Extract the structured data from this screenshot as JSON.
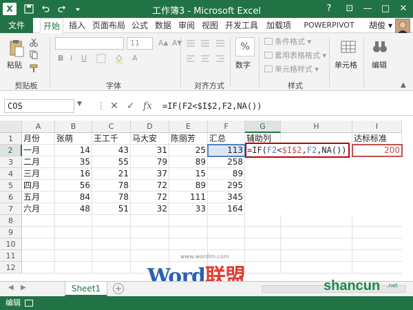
{
  "window": {
    "app_icon": "X",
    "title": "工作簿3 - Microsoft Excel",
    "controls": [
      "?",
      "⊡",
      "—",
      "□",
      "✕"
    ]
  },
  "icons": {
    "save": "save-icon",
    "undo": "undo-icon",
    "redo": "redo-icon",
    "user_avatar": "avatar-icon"
  },
  "menu": {
    "file": "文件",
    "tabs": [
      "开始",
      "插入",
      "页面布局",
      "公式",
      "数据",
      "审阅",
      "视图",
      "开发工具",
      "加载项",
      "POWERPIVOT"
    ],
    "user": "胡俊 ▾"
  },
  "ribbon": {
    "clipboard": {
      "paste": "粘贴",
      "label": "剪贴板"
    },
    "font": {
      "font_size": "11",
      "label": "字体",
      "bold": "B",
      "italic": "I",
      "underline": "U"
    },
    "align": {
      "label": "对齐方式"
    },
    "number": {
      "button": "数字",
      "symbol": "%"
    },
    "styles": {
      "cond_format": "条件格式 ▾",
      "table_format": "套用表格格式 ▾",
      "cell_style": "单元格样式 ▾",
      "label": "样式"
    },
    "cells": {
      "button": "单元格"
    },
    "editing": {
      "button": "编辑"
    }
  },
  "formula_bar": {
    "name_box": "COS",
    "cancel": "✕",
    "enter": "✓",
    "fx": "fx",
    "formula": "=IF(F2<$I$2,F2,NA())"
  },
  "columns": [
    "A",
    "B",
    "C",
    "D",
    "E",
    "F",
    "G",
    "H",
    "I"
  ],
  "rows": [
    "1",
    "2",
    "3",
    "4",
    "5",
    "6",
    "7",
    "8",
    "9",
    "10",
    "11",
    "12"
  ],
  "table": {
    "headers": [
      "月份",
      "张萌",
      "王工千",
      "马大安",
      "陈丽芳",
      "汇总",
      "辅助列",
      "",
      "达标标准"
    ],
    "data": [
      [
        "一月",
        "14",
        "43",
        "31",
        "25",
        "113"
      ],
      [
        "二月",
        "35",
        "55",
        "79",
        "89",
        "258"
      ],
      [
        "三月",
        "16",
        "21",
        "37",
        "15",
        "89"
      ],
      [
        "四月",
        "56",
        "78",
        "72",
        "89",
        "295"
      ],
      [
        "五月",
        "84",
        "78",
        "72",
        "111",
        "345"
      ],
      [
        "六月",
        "48",
        "51",
        "32",
        "33",
        "164"
      ]
    ],
    "edit_cell": {
      "prefix": "=IF(",
      "ref1": "F2",
      "lt": "<",
      "ref2": "$I$2",
      "comma": ",",
      "ref3": "F2",
      "rest": ",NA())"
    },
    "target_value": "200"
  },
  "sheets": {
    "active": "Sheet1",
    "add": "+"
  },
  "status": {
    "mode": "编辑"
  },
  "watermarks": {
    "word": "Word",
    "lianmeng": "联盟",
    "url": "www.wordlm.com",
    "shancun": "shancun",
    "net": ".net"
  }
}
